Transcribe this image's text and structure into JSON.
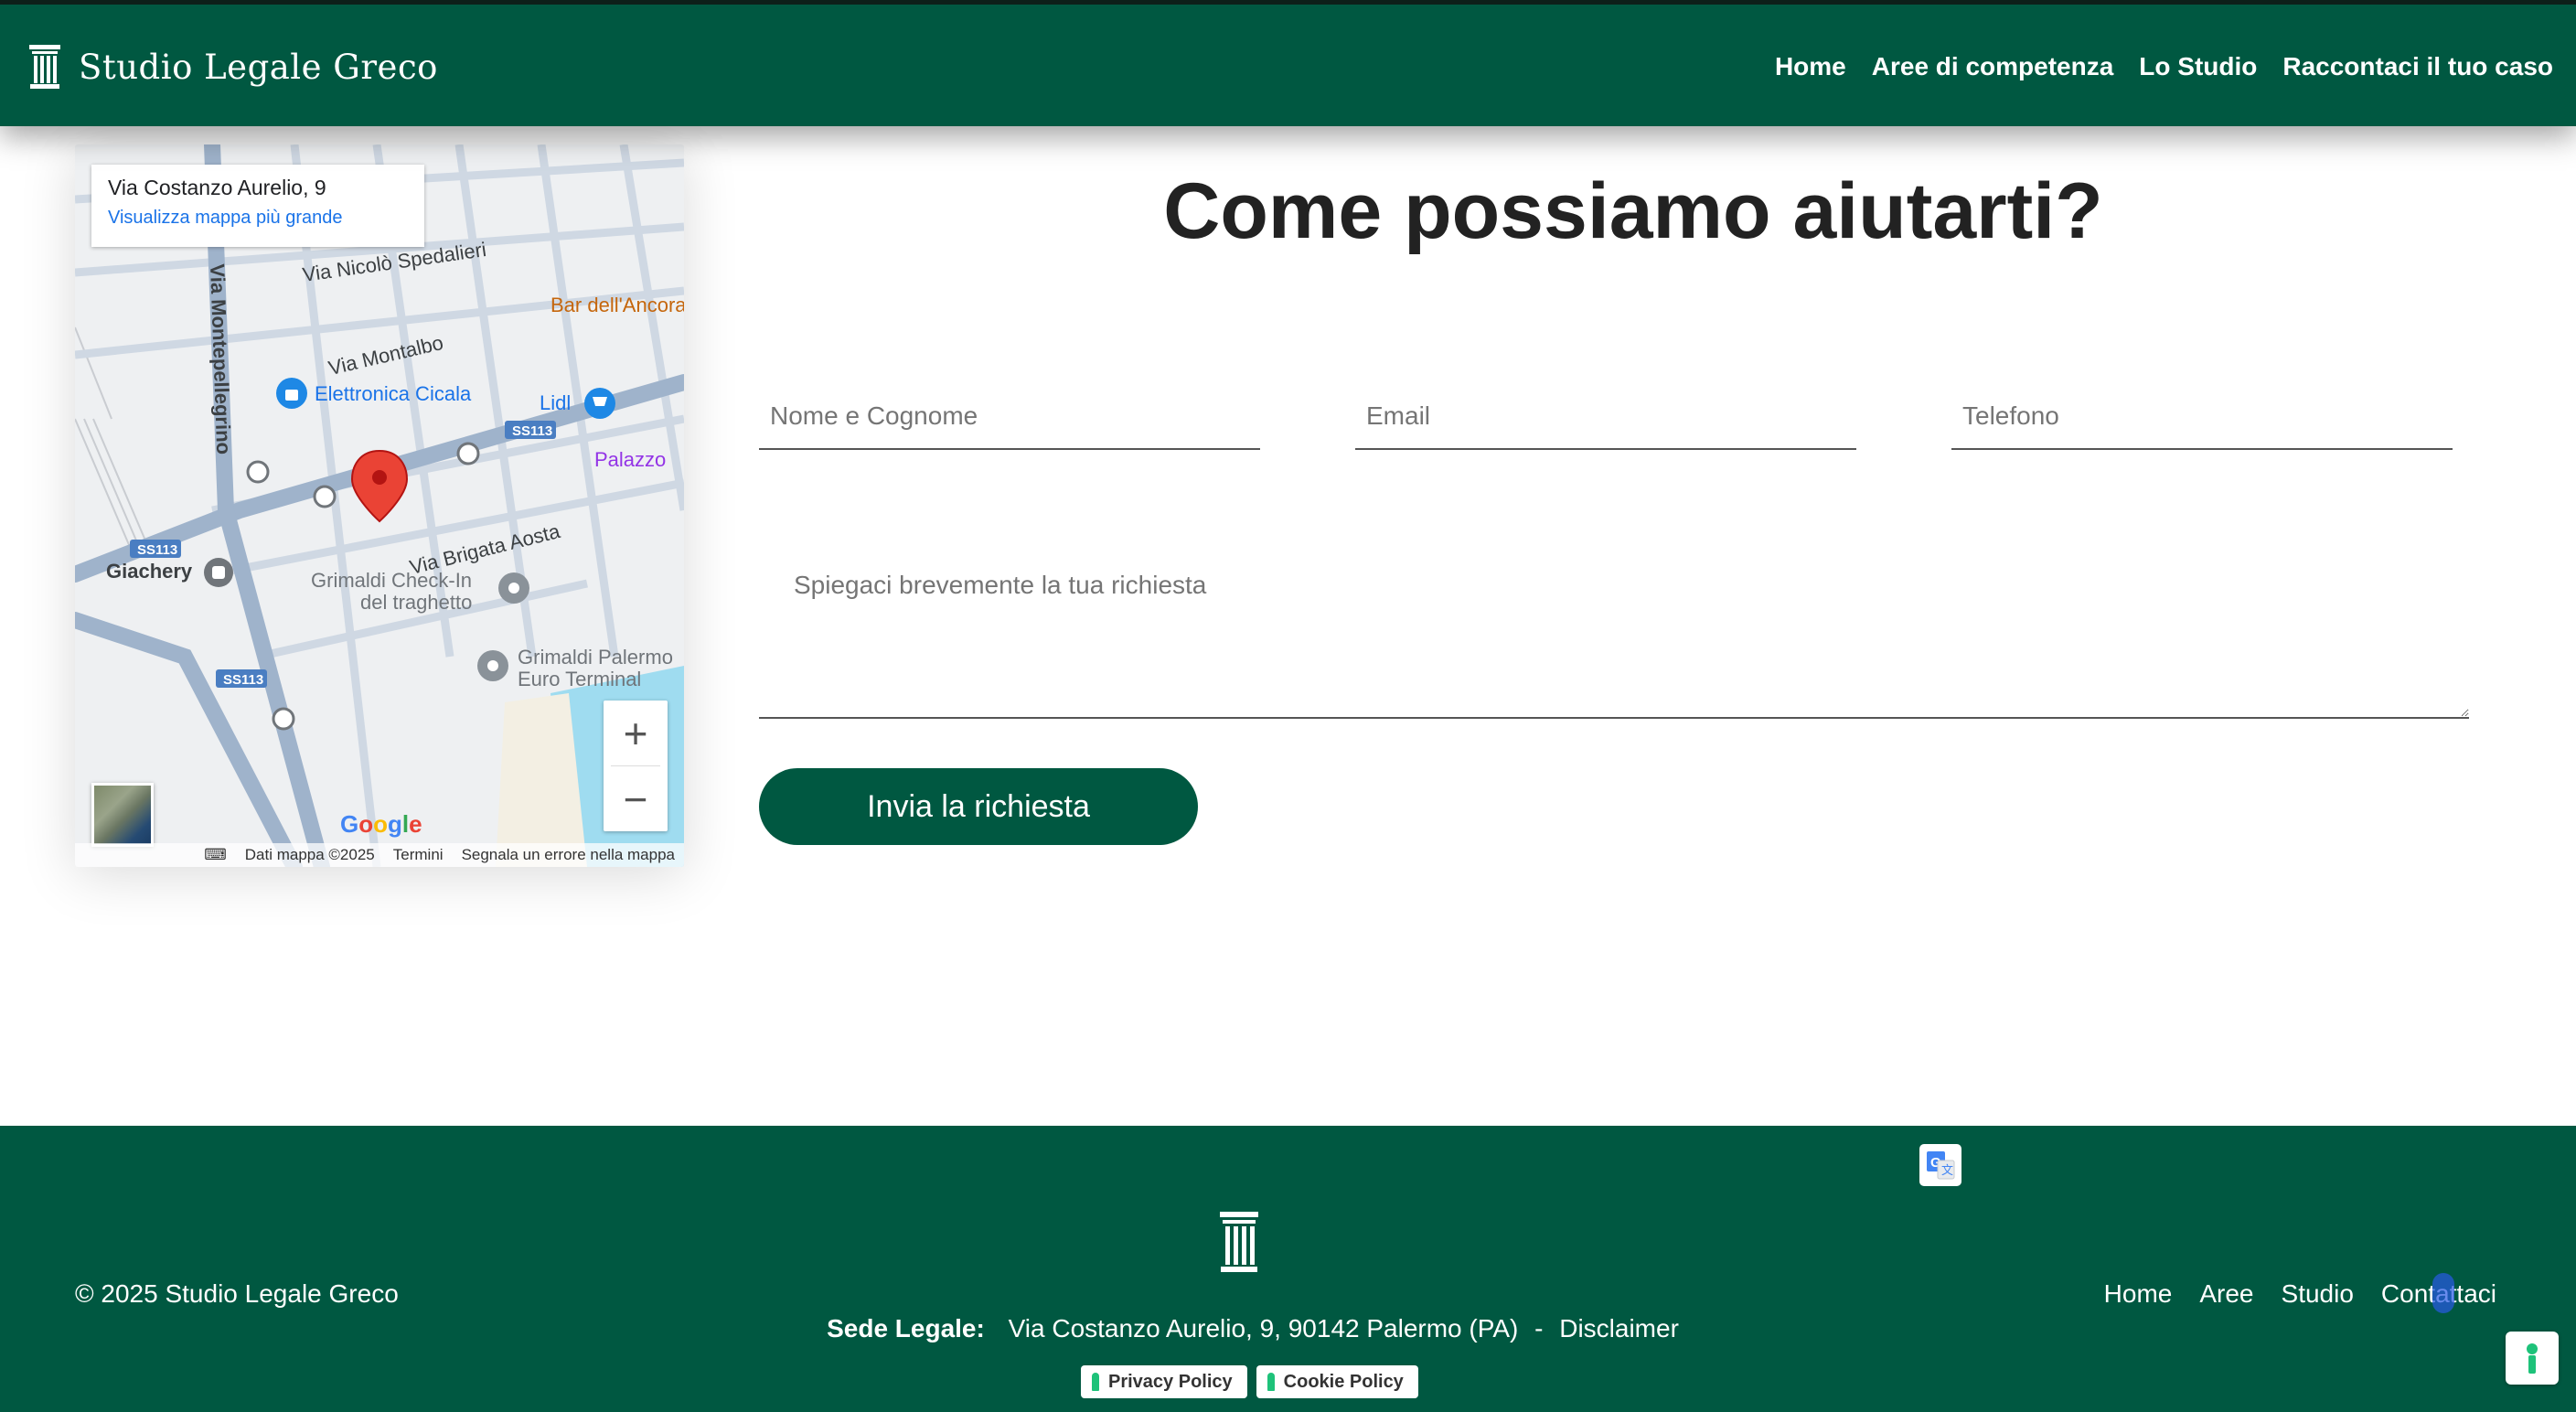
{
  "header": {
    "brand": "Studio Legale Greco",
    "nav": [
      "Home",
      "Aree di competenza",
      "Lo Studio",
      "Raccontaci il tuo caso"
    ]
  },
  "map": {
    "place_title": "Via Costanzo Aurelio, 9",
    "place_link": "Visualizza mappa più grande",
    "labels": {
      "via_spedalieri": "Via Nicolò Spedalieri",
      "montepellegrino": "Via Montepellegrino",
      "bar": "Bar dell'Ancora",
      "via_montalbo": "Via Montalbo",
      "elettronica": "Elettronica Cicala",
      "lidl": "Lidl",
      "ss113": "SS113",
      "palazzo": "Palazzo",
      "via_brigata": "Via Brigata Aosta",
      "giachery": "Giachery",
      "grimaldi_checkin": "Grimaldi Check-In",
      "del_traghetto": "del traghetto",
      "grimaldi_palermo": "Grimaldi Palermo",
      "euro_terminal": "Euro Terminal",
      "google": "Google"
    },
    "footer": [
      "Dati mappa ©2025",
      "Termini",
      "Segnala un errore nella mappa"
    ],
    "zoom_in": "+",
    "zoom_out": "−"
  },
  "form": {
    "title": "Come possiamo aiutarti?",
    "name_placeholder": "Nome e Cognome",
    "email_placeholder": "Email",
    "phone_placeholder": "Telefono",
    "message_placeholder": "Spiegaci brevemente la tua richiesta",
    "submit_label": "Invia la richiesta"
  },
  "footer": {
    "copyright": "© 2025 Studio Legale Greco",
    "nav": [
      "Home",
      "Aree",
      "Studio",
      "Contattaci"
    ],
    "address_label": "Sede Legale:",
    "address": "Via Costanzo Aurelio, 9, 90142 Palermo (PA)",
    "separator": "-",
    "disclaimer": "Disclaimer",
    "privacy_policy": "Privacy Policy",
    "cookie_policy": "Cookie Policy"
  },
  "colors": {
    "brand_green": "#005841",
    "map_pin": "#ea4335",
    "link_blue": "#1a73e8"
  },
  "icons": [
    "column-logo-icon",
    "map-pin-icon",
    "shopping-cart-icon",
    "bus-stop-icon",
    "translate-icon",
    "iubenda-icon"
  ]
}
